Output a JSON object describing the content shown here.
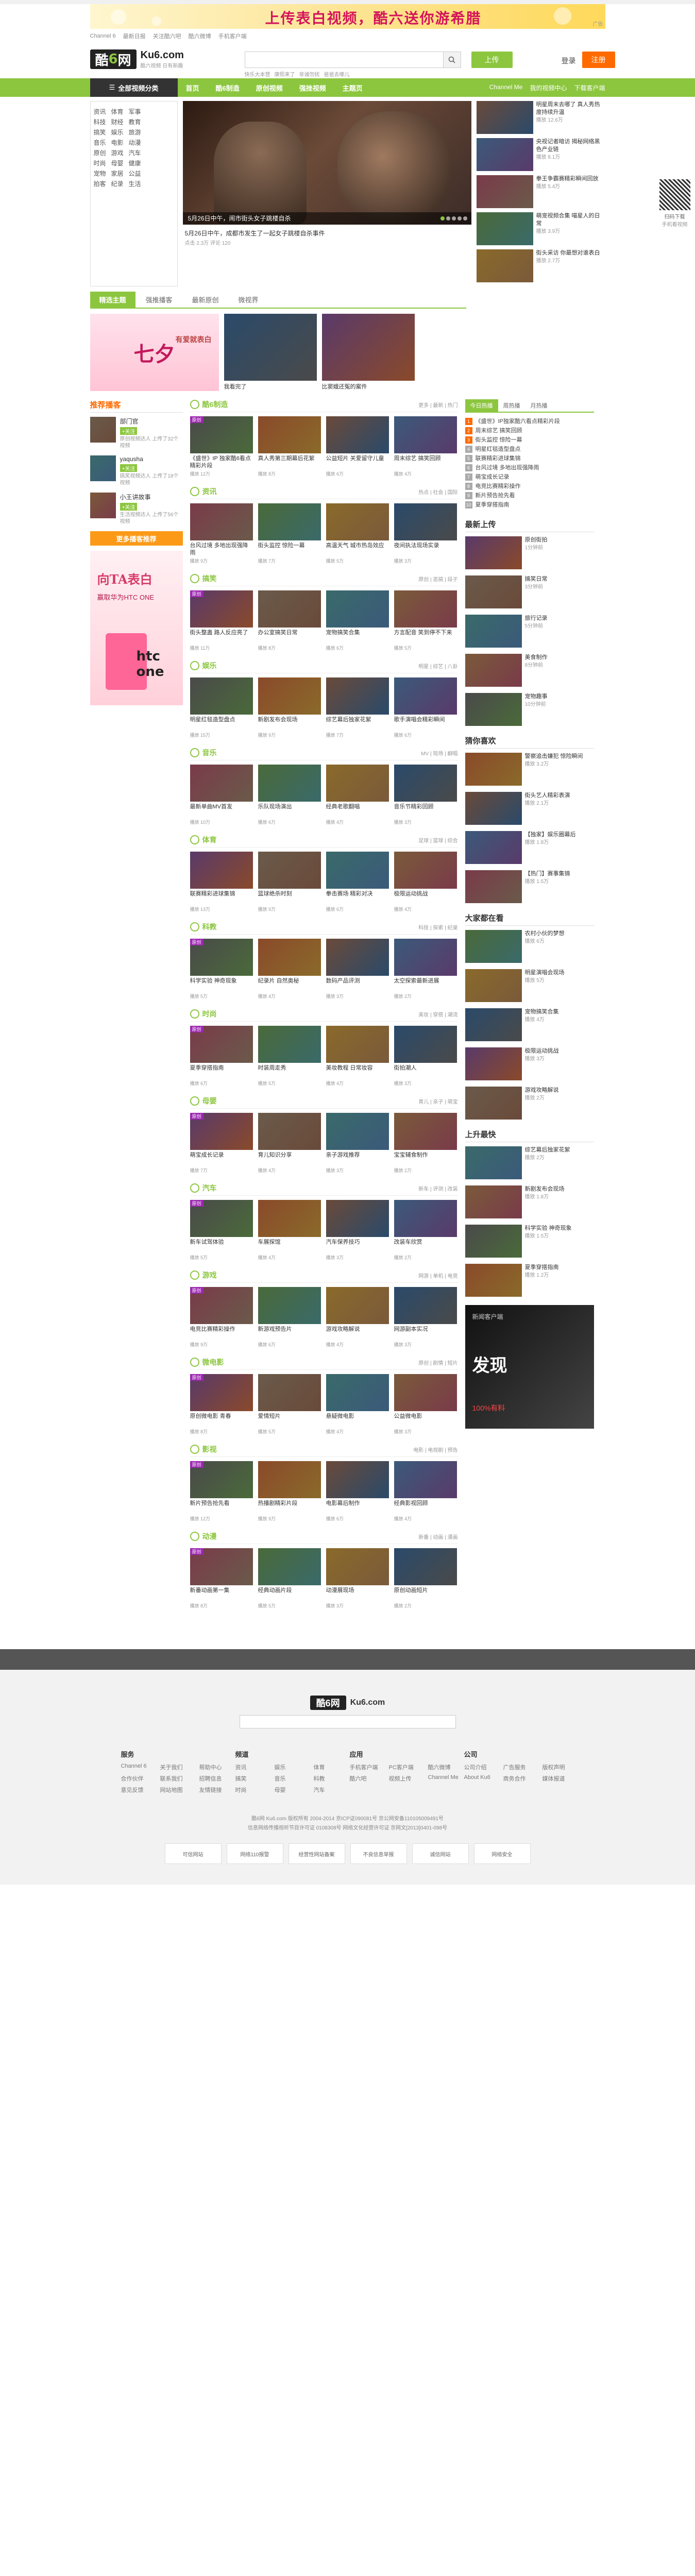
{
  "ad_banner": {
    "brand": "上传表白视频，酷六送你游希腊",
    "tagline": "",
    "label": "广告"
  },
  "topbar": [
    "Channel 6",
    "最新日报",
    "关注酷六吧",
    "酷六微博",
    "手机客户端"
  ],
  "header": {
    "logo_text": "酷6网",
    "domain": "Ku6.com",
    "slogan": "酷六视频 日有新趣",
    "search_placeholder": "",
    "hot_words": [
      "快乐大本营",
      "康熙来了",
      "非诚勿扰",
      "爸爸去哪儿"
    ],
    "upload_label": "上传",
    "login_label": "登录",
    "register_label": "注册"
  },
  "navbar": {
    "all_category": "全部视频分类",
    "items": [
      "首页",
      "酷6制造",
      "原创视频",
      "强挫视频",
      "主题页"
    ],
    "right": [
      "Channel Me",
      "我的视频中心",
      "下载客户端"
    ]
  },
  "float_widget": {
    "label": "扫码下载",
    "sub": "手机看视频"
  },
  "categories": [
    [
      "资讯",
      "体育",
      "军事"
    ],
    [
      "科技",
      "财经",
      "教育"
    ],
    [
      "搞笑",
      "娱乐",
      "旅游"
    ],
    [
      "音乐",
      "电影",
      "动漫"
    ],
    [
      "原创",
      "游戏",
      "汽车"
    ],
    [
      "时尚",
      "母婴",
      "健康"
    ],
    [
      "宠物",
      "家居",
      "公益"
    ],
    [
      "拍客",
      "纪录",
      "生活"
    ]
  ],
  "focus": {
    "caption": "5月26日中午，闹市街头女子跳楼自杀",
    "desc": "5月26日中午，成都市发生了一起女子跳楼自杀事件",
    "meta": "点击 2.3万  评论 120"
  },
  "side_items": [
    {
      "title": "明星周末去哪了 真人秀热度持续升温",
      "meta": "播放 12.6万"
    },
    {
      "title": "央视记者暗访 揭秘网络黑色产业链",
      "meta": "播放 8.1万"
    },
    {
      "title": "拳王争霸赛精彩瞬间回放",
      "meta": "播放 5.4万"
    },
    {
      "title": "萌宠视频合集 喵星人的日常",
      "meta": "播放 3.9万"
    },
    {
      "title": "街头采访 你最想对谁表白",
      "meta": "播放 2.7万"
    }
  ],
  "tabs": [
    "精选主题",
    "强推播客",
    "最新原创",
    "微视界"
  ],
  "featured": [
    {
      "cap": "七夕不要散 8.13 有爱就表白"
    },
    {
      "cap": "我看完了"
    },
    {
      "cap": "比窦娥还冤的案件"
    }
  ],
  "promo_big": {
    "title": "七夕",
    "small": "有爱就表白"
  },
  "left": {
    "title": "推荐播客",
    "people": [
      {
        "name": "部门官",
        "follow": "+关注",
        "sub": "原创视频达人 上传了32个视频"
      },
      {
        "name": "yaqusha",
        "follow": "+关注",
        "sub": "搞笑视频达人 上传了18个视频"
      },
      {
        "name": "小王讲故事",
        "follow": "+关注",
        "sub": "生活视频达人 上传了56个视频"
      }
    ],
    "ad1": "更多播客推荐",
    "ad2": {
      "t1": "向TA表白",
      "t2": "赢取华为HTC ONE",
      "brand": "htc one"
    }
  },
  "channels": [
    {
      "name": "酷6制造",
      "tags": "更多 | 最新 | 热门",
      "videos": [
        {
          "t": "《盛世》IP 独家酷6看点精彩片段",
          "m": "播放 12万",
          "flag": "原创"
        },
        {
          "t": "真人秀第三期幕后花絮",
          "m": "播放 8万",
          "flag": ""
        },
        {
          "t": "公益短片 关爱留守儿童",
          "m": "播放 6万",
          "flag": ""
        },
        {
          "t": "周末综艺 搞笑回顾",
          "m": "播放 4万",
          "flag": ""
        }
      ]
    },
    {
      "name": "资讯",
      "tags": "热点 | 社会 | 国际",
      "videos": [
        {
          "t": "台风过境 多地出现强降雨",
          "m": "播放 9万",
          "flag": ""
        },
        {
          "t": "街头监控 惊险一幕",
          "m": "播放 7万",
          "flag": ""
        },
        {
          "t": "高温天气 城市热岛效应",
          "m": "播放 5万",
          "flag": ""
        },
        {
          "t": "夜间执法现场实录",
          "m": "播放 3万",
          "flag": ""
        }
      ]
    },
    {
      "name": "搞笑",
      "tags": "原创 | 恶搞 | 段子",
      "videos": [
        {
          "t": "街头整蛊 路人反应亮了",
          "m": "播放 11万",
          "flag": "原创"
        },
        {
          "t": "办公室搞笑日常",
          "m": "播放 8万",
          "flag": ""
        },
        {
          "t": "宠物搞笑合集",
          "m": "播放 6万",
          "flag": ""
        },
        {
          "t": "方言配音 笑到停不下来",
          "m": "播放 5万",
          "flag": ""
        }
      ]
    },
    {
      "name": "娱乐",
      "tags": "明星 | 综艺 | 八卦",
      "videos": [
        {
          "t": "明星红毯造型盘点",
          "m": "播放 15万",
          "flag": ""
        },
        {
          "t": "新剧发布会现场",
          "m": "播放 9万",
          "flag": ""
        },
        {
          "t": "综艺幕后独家花絮",
          "m": "播放 7万",
          "flag": ""
        },
        {
          "t": "歌手演唱会精彩瞬间",
          "m": "播放 6万",
          "flag": ""
        }
      ]
    },
    {
      "name": "音乐",
      "tags": "MV | 现场 | 翻唱",
      "videos": [
        {
          "t": "最新单曲MV首发",
          "m": "播放 10万",
          "flag": ""
        },
        {
          "t": "乐队现场演出",
          "m": "播放 6万",
          "flag": ""
        },
        {
          "t": "经典老歌翻唱",
          "m": "播放 4万",
          "flag": ""
        },
        {
          "t": "音乐节精彩回顾",
          "m": "播放 3万",
          "flag": ""
        }
      ]
    },
    {
      "name": "体育",
      "tags": "足球 | 篮球 | 综合",
      "videos": [
        {
          "t": "联赛精彩进球集锦",
          "m": "播放 13万",
          "flag": ""
        },
        {
          "t": "篮球绝杀时刻",
          "m": "播放 9万",
          "flag": ""
        },
        {
          "t": "拳击赛场 精彩对决",
          "m": "播放 6万",
          "flag": ""
        },
        {
          "t": "极限运动挑战",
          "m": "播放 4万",
          "flag": ""
        }
      ]
    },
    {
      "name": "科教",
      "tags": "科技 | 探索 | 纪录",
      "videos": [
        {
          "t": "科学实验 神奇现象",
          "m": "播放 5万",
          "flag": "原创"
        },
        {
          "t": "纪录片 自然奥秘",
          "m": "播放 4万",
          "flag": ""
        },
        {
          "t": "数码产品评测",
          "m": "播放 3万",
          "flag": ""
        },
        {
          "t": "太空探索最新进展",
          "m": "播放 2万",
          "flag": ""
        }
      ]
    },
    {
      "name": "时尚",
      "tags": "美妆 | 穿搭 | 潮流",
      "videos": [
        {
          "t": "夏季穿搭指南",
          "m": "播放 6万",
          "flag": "原创"
        },
        {
          "t": "时装周走秀",
          "m": "播放 5万",
          "flag": ""
        },
        {
          "t": "美妆教程 日常妆容",
          "m": "播放 4万",
          "flag": ""
        },
        {
          "t": "街拍潮人",
          "m": "播放 3万",
          "flag": ""
        }
      ]
    },
    {
      "name": "母婴",
      "tags": "育儿 | 亲子 | 萌宝",
      "videos": [
        {
          "t": "萌宝成长记录",
          "m": "播放 7万",
          "flag": "原创"
        },
        {
          "t": "育儿知识分享",
          "m": "播放 4万",
          "flag": ""
        },
        {
          "t": "亲子游戏推荐",
          "m": "播放 3万",
          "flag": ""
        },
        {
          "t": "宝宝辅食制作",
          "m": "播放 2万",
          "flag": ""
        }
      ]
    },
    {
      "name": "汽车",
      "tags": "新车 | 评测 | 改装",
      "videos": [
        {
          "t": "新车试驾体验",
          "m": "播放 5万",
          "flag": "原创"
        },
        {
          "t": "车展探馆",
          "m": "播放 4万",
          "flag": ""
        },
        {
          "t": "汽车保养技巧",
          "m": "播放 3万",
          "flag": ""
        },
        {
          "t": "改装车欣赏",
          "m": "播放 2万",
          "flag": ""
        }
      ]
    },
    {
      "name": "游戏",
      "tags": "网游 | 单机 | 电竞",
      "videos": [
        {
          "t": "电竞比赛精彩操作",
          "m": "播放 9万",
          "flag": "原创"
        },
        {
          "t": "新游戏预告片",
          "m": "播放 6万",
          "flag": ""
        },
        {
          "t": "游戏攻略解说",
          "m": "播放 4万",
          "flag": ""
        },
        {
          "t": "网游副本实况",
          "m": "播放 3万",
          "flag": ""
        }
      ]
    },
    {
      "name": "微电影",
      "tags": "原创 | 剧情 | 短片",
      "videos": [
        {
          "t": "原创微电影 青春",
          "m": "播放 8万",
          "flag": "原创"
        },
        {
          "t": "爱情短片",
          "m": "播放 5万",
          "flag": ""
        },
        {
          "t": "悬疑微电影",
          "m": "播放 4万",
          "flag": ""
        },
        {
          "t": "公益微电影",
          "m": "播放 3万",
          "flag": ""
        }
      ]
    },
    {
      "name": "影视",
      "tags": "电影 | 电视剧 | 预告",
      "videos": [
        {
          "t": "新片预告抢先看",
          "m": "播放 12万",
          "flag": "原创"
        },
        {
          "t": "热播剧精彩片段",
          "m": "播放 9万",
          "flag": ""
        },
        {
          "t": "电影幕后制作",
          "m": "播放 6万",
          "flag": ""
        },
        {
          "t": "经典影视回顾",
          "m": "播放 4万",
          "flag": ""
        }
      ]
    },
    {
      "name": "动漫",
      "tags": "新番 | 动画 | 漫画",
      "videos": [
        {
          "t": "新番动画第一集",
          "m": "播放 8万",
          "flag": "原创"
        },
        {
          "t": "经典动画片段",
          "m": "播放 5万",
          "flag": ""
        },
        {
          "t": "动漫展现场",
          "m": "播放 3万",
          "flag": ""
        },
        {
          "t": "原创动画短片",
          "m": "播放 2万",
          "flag": ""
        }
      ]
    }
  ],
  "right": {
    "tabs": [
      "今日热播",
      "周热播",
      "月热播"
    ],
    "rank": [
      "《盛世》IP独家酷六看点精彩片段",
      "周末综艺 搞笑回顾",
      "街头监控 惊险一幕",
      "明星红毯造型盘点",
      "联赛精彩进球集锦",
      "台风过境 多地出现强降雨",
      "萌宝成长记录",
      "电竞比赛精彩操作",
      "新片预告抢先看",
      "夏季穿搭指南"
    ],
    "upload_title": "最新上传",
    "upload_items": [
      {
        "t": "原创街拍",
        "m": "1分钟前"
      },
      {
        "t": "搞笑日常",
        "m": "3分钟前"
      },
      {
        "t": "旅行记录",
        "m": "5分钟前"
      },
      {
        "t": "美食制作",
        "m": "8分钟前"
      },
      {
        "t": "宠物趣事",
        "m": "10分钟前"
      }
    ],
    "like_title": "猜你喜欢",
    "like_items": [
      {
        "t": "警察追击嫌犯 惊险瞬间",
        "m": "播放 3.2万"
      },
      {
        "t": "街头艺人精彩表演",
        "m": "播放 2.1万"
      },
      {
        "t": "【独家】娱乐圈幕后",
        "m": "播放 1.8万"
      },
      {
        "t": "【热门】赛事集锦",
        "m": "播放 1.5万"
      }
    ],
    "rank2_title": "大家都在看",
    "rank2_items": [
      {
        "t": "农村小伙的梦想",
        "m": "播放 6万"
      },
      {
        "t": "明星演唱会现场",
        "m": "播放 5万"
      },
      {
        "t": "宠物搞笑合集",
        "m": "播放 4万"
      },
      {
        "t": "极限运动挑战",
        "m": "播放 3万"
      },
      {
        "t": "游戏攻略解说",
        "m": "播放 2万"
      }
    ],
    "rise_title": "上升最快",
    "rise_items": [
      {
        "t": "综艺幕后独家花絮",
        "m": "播放 2万"
      },
      {
        "t": "新剧发布会现场",
        "m": "播放 1.8万"
      },
      {
        "t": "科学实验 神奇现象",
        "m": "播放 1.5万"
      },
      {
        "t": "夏季穿搭指南",
        "m": "播放 1.2万"
      }
    ],
    "ad": {
      "head": "新闻客户端",
      "big": "发现",
      "slogan": "100%有料"
    }
  },
  "footer": {
    "search_placeholder": "",
    "cols": [
      {
        "title": "服务",
        "items": [
          "Channel 6",
          "关于我们",
          "帮助中心",
          "合作伙伴",
          "联系我们",
          "招聘信息",
          "意见反馈",
          "网站地图",
          "友情链接"
        ]
      },
      {
        "title": "频道",
        "items": [
          "资讯",
          "娱乐",
          "体育",
          "搞笑",
          "音乐",
          "科教",
          "时尚",
          "母婴",
          "汽车"
        ]
      },
      {
        "title": "应用",
        "items": [
          "手机客户端",
          "PC客户端",
          "酷六微博",
          "酷六吧",
          "视频上传",
          "Channel Me"
        ]
      },
      {
        "title": "公司",
        "items": [
          "公司介绍",
          "广告服务",
          "版权声明",
          "About Ku6",
          "商务合作",
          "媒体报道"
        ]
      }
    ],
    "copyright": "酷6网 Ku6.com 版权所有 2004-2014  京ICP证090081号  京公网安备110105009491号",
    "license": "信息网络传播视听节目许可证 0108308号  网络文化经营许可证 京网文[2013]0401-098号",
    "badges": [
      "可信网站",
      "网络110报警",
      "经营性网站备案",
      "不良信息举报",
      "诚信网站",
      "网络安全"
    ]
  }
}
